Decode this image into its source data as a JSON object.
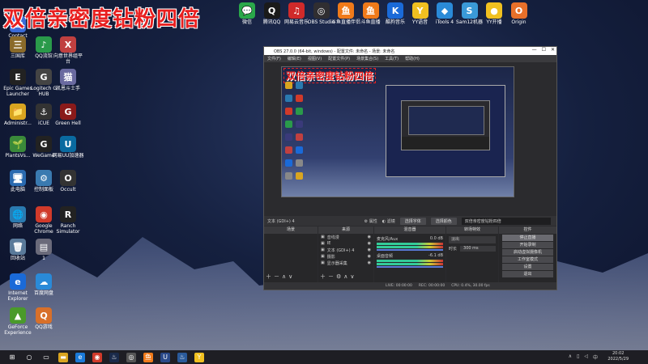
{
  "overlay_title": "双倍亲密度钻粉四倍",
  "desktop_icons": [
    {
      "id": "contact",
      "label": "Contact",
      "glyph": "☎",
      "color": "#3b6bd8"
    },
    {
      "id": "wenku",
      "label": "三国库",
      "glyph": "三",
      "color": "#8a6a2a"
    },
    {
      "id": "qqmusic",
      "label": "QQ流馆",
      "glyph": "♪",
      "color": "#2a9a4a"
    },
    {
      "id": "xiao",
      "label": "向意世界组平台",
      "glyph": "X",
      "color": "#c04040"
    },
    {
      "id": "epic",
      "label": "Epic Games Launcher",
      "glyph": "E",
      "color": "#222"
    },
    {
      "id": "logitech",
      "label": "Logitech G HUB",
      "glyph": "G",
      "color": "#444"
    },
    {
      "id": "zeneko",
      "label": "凯恩斗士手",
      "glyph": "猫",
      "color": "#6a6aa0"
    },
    {
      "id": "admin",
      "label": "Administr...",
      "glyph": "📁",
      "color": "#d9a520"
    },
    {
      "id": "icue",
      "label": "iCUE",
      "glyph": "⚓",
      "color": "#333"
    },
    {
      "id": "greenhell",
      "label": "Green Hell",
      "glyph": "G",
      "color": "#8a1a1a"
    },
    {
      "id": "plants",
      "label": "PlantsVs...",
      "glyph": "🌱",
      "color": "#3a8a3a"
    },
    {
      "id": "wegame",
      "label": "WeGame",
      "glyph": "G",
      "color": "#222"
    },
    {
      "id": "wangyi",
      "label": "网易UU加速器",
      "glyph": "U",
      "color": "#0a6aa0"
    },
    {
      "id": "computer",
      "label": "此电脑",
      "glyph": "🖥",
      "color": "#2a6ab0"
    },
    {
      "id": "control",
      "label": "控制面板",
      "glyph": "⚙",
      "color": "#3a7ab0"
    },
    {
      "id": "occult",
      "label": "Occult",
      "glyph": "O",
      "color": "#333"
    },
    {
      "id": "network",
      "label": "网络",
      "glyph": "🌐",
      "color": "#2a7ab0"
    },
    {
      "id": "chrome",
      "label": "Google Chrome",
      "glyph": "◉",
      "color": "#d03a2a"
    },
    {
      "id": "ranch",
      "label": "Ranch Simulator",
      "glyph": "R",
      "color": "#222"
    },
    {
      "id": "recycle",
      "label": "回收站",
      "glyph": "🗑",
      "color": "#5a7a9a"
    },
    {
      "id": "file",
      "label": "1",
      "glyph": "▤",
      "color": "#6a6a7a"
    },
    {
      "id": "ie",
      "label": "Internet Explorer",
      "glyph": "e",
      "color": "#1a6ad8"
    },
    {
      "id": "baidu",
      "label": "百度网盘",
      "glyph": "☁",
      "color": "#2a8ad8"
    },
    {
      "id": "geforce",
      "label": "GeForce Experience",
      "glyph": "▲",
      "color": "#4a9a2a"
    },
    {
      "id": "qqgame",
      "label": "QQ游戏",
      "glyph": "Q",
      "color": "#d8702a"
    }
  ],
  "top_icons": [
    {
      "id": "wechat",
      "label": "微信",
      "glyph": "💬",
      "color": "#2aa84a"
    },
    {
      "id": "tqq",
      "label": "腾讯QQ",
      "glyph": "Q",
      "color": "#1a1a1a"
    },
    {
      "id": "cloudmusic",
      "label": "网易云音乐",
      "glyph": "♫",
      "color": "#d02a2a"
    },
    {
      "id": "obs",
      "label": "OBS Studio",
      "glyph": "◎",
      "color": "#302e31"
    },
    {
      "id": "douyu1",
      "label": "斗鱼直播伴侣",
      "glyph": "鱼",
      "color": "#f07a1a"
    },
    {
      "id": "douyu2",
      "label": "斗鱼直播",
      "glyph": "鱼",
      "color": "#f07a1a"
    },
    {
      "id": "kugou",
      "label": "酷狗音乐",
      "glyph": "K",
      "color": "#1a6ad8"
    },
    {
      "id": "yy",
      "label": "YY语音",
      "glyph": "Y",
      "color": "#f0c020"
    },
    {
      "id": "itools",
      "label": "iTools 4",
      "glyph": "◆",
      "color": "#2a8ad8"
    },
    {
      "id": "sam",
      "label": "Sam12机器",
      "glyph": "S",
      "color": "#3a9ad8"
    },
    {
      "id": "yykaibo",
      "label": "YY开播",
      "glyph": "●",
      "color": "#f0c020"
    },
    {
      "id": "origin",
      "label": "Origin",
      "glyph": "O",
      "color": "#e8702a"
    }
  ],
  "obs": {
    "title": "OBS 27.0.0 (64-bit, windows) - 配置文件: 未命名 - 场景: 未命名",
    "menu": [
      "文件(F)",
      "编辑(E)",
      "视图(V)",
      "配置文件(P)",
      "场景集合(S)",
      "工具(T)",
      "帮助(H)"
    ],
    "preview_title": "双倍亲密度钻粉四倍",
    "source_bar_label": "文本 (GDI+) 4",
    "props_label": "属性",
    "filters_label": "滤镜",
    "select_font": "选择字体",
    "select_color": "选择颜色",
    "text_value": "双倍亲密度钻粉四倍",
    "docks": {
      "scenes": "场景",
      "sources": "来源",
      "mixer": "混音器",
      "transitions": "转场特效",
      "controls": "控件"
    },
    "sources": [
      "音线漫",
      "IE",
      "文本 (GDI+) 4",
      "摄影",
      "显示器采集"
    ],
    "mixer": [
      {
        "name": "麦克风/Aux",
        "level": "0.0 dB"
      },
      {
        "name": "桌面音频",
        "level": "-6.1 dB"
      }
    ],
    "transition": "淡出",
    "duration_label": "时长",
    "duration": "300 ms",
    "controls": [
      "停止直播",
      "开始录制",
      "启动虚拟摄像机",
      "工作室模式",
      "设置",
      "退出"
    ],
    "status": {
      "live": "LIVE: 00:00:00",
      "rec": "REC: 00:00:00",
      "cpu": "CPU: 0.4%, 30.00 fps"
    }
  },
  "taskbar": {
    "time": "20:02",
    "date": "2022/5/29"
  }
}
